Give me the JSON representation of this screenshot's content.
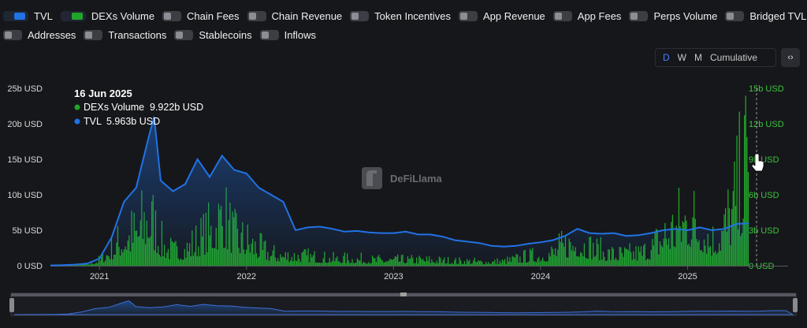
{
  "toggles": [
    {
      "label": "TVL",
      "on": true,
      "color": "#2172e5"
    },
    {
      "label": "DEXs Volume",
      "on": true,
      "color": "#21a529"
    },
    {
      "label": "Chain Fees",
      "on": false
    },
    {
      "label": "Chain Revenue",
      "on": false
    },
    {
      "label": "Token Incentives",
      "on": false
    },
    {
      "label": "App Revenue",
      "on": false
    },
    {
      "label": "App Fees",
      "on": false
    },
    {
      "label": "Perps Volume",
      "on": false
    },
    {
      "label": "Bridged TVL",
      "on": false
    },
    {
      "label": "Addresses",
      "on": false
    },
    {
      "label": "Transactions",
      "on": false
    },
    {
      "label": "Stablecoins",
      "on": false
    },
    {
      "label": "Inflows",
      "on": false
    }
  ],
  "intervals": {
    "options": [
      "D",
      "W",
      "M",
      "Cumulative"
    ],
    "selected": "D"
  },
  "embed_label": "‹›",
  "watermark": "DeFiLlama",
  "tooltip": {
    "date": "16 Jun 2025",
    "rows": [
      {
        "label": "DEXs Volume",
        "value": "9.922b USD",
        "color": "#21a529"
      },
      {
        "label": "TVL",
        "value": "5.963b USD",
        "color": "#2172e5"
      }
    ]
  },
  "chart_data": {
    "type": "area",
    "x_ticks": [
      "2021",
      "2022",
      "2023",
      "2024",
      "2025"
    ],
    "x_range": [
      "2020-09",
      "2025-06"
    ],
    "y_left": {
      "ticks": [
        "0 USD",
        "5b USD",
        "10b USD",
        "15b USD",
        "20b USD",
        "25b USD"
      ],
      "range": [
        0,
        25
      ]
    },
    "y_right": {
      "ticks": [
        "0 USD",
        "3b USD",
        "6b USD",
        "9b USD",
        "12b USD",
        "15b USD"
      ],
      "range": [
        0,
        15
      ]
    },
    "grid": false,
    "series": [
      {
        "name": "TVL",
        "axis": "left",
        "color": "#2172e5",
        "style": "area",
        "x": [
          "2020-09",
          "2020-10",
          "2020-11",
          "2020-12",
          "2021-01",
          "2021-02",
          "2021-03",
          "2021-04",
          "2021-05-01",
          "2021-05-15",
          "2021-06",
          "2021-07",
          "2021-08",
          "2021-09",
          "2021-10",
          "2021-11",
          "2021-12",
          "2022-01",
          "2022-02",
          "2022-03",
          "2022-04",
          "2022-05",
          "2022-06",
          "2022-07",
          "2022-08",
          "2022-09",
          "2022-10",
          "2022-11",
          "2022-12",
          "2023-01",
          "2023-02",
          "2023-03",
          "2023-04",
          "2023-05",
          "2023-06",
          "2023-07",
          "2023-08",
          "2023-09",
          "2023-10",
          "2023-11",
          "2023-12",
          "2024-01",
          "2024-02",
          "2024-03",
          "2024-04",
          "2024-05",
          "2024-06",
          "2024-07",
          "2024-08",
          "2024-09",
          "2024-10",
          "2024-11",
          "2024-12",
          "2025-01",
          "2025-02",
          "2025-03",
          "2025-04",
          "2025-05",
          "2025-06"
        ],
        "y": [
          0.05,
          0.08,
          0.15,
          0.3,
          1.0,
          4.0,
          9.0,
          11.0,
          18.0,
          21.0,
          12.0,
          10.5,
          11.5,
          15.0,
          12.5,
          15.5,
          13.5,
          13.0,
          11.0,
          10.0,
          9.0,
          5.0,
          5.4,
          5.5,
          5.2,
          4.8,
          4.9,
          4.7,
          4.6,
          4.6,
          4.8,
          4.4,
          4.4,
          4.1,
          3.6,
          3.4,
          3.2,
          2.8,
          2.7,
          2.8,
          3.1,
          3.3,
          3.6,
          4.2,
          5.2,
          4.6,
          4.5,
          4.6,
          4.2,
          4.3,
          4.6,
          5.0,
          5.2,
          5.0,
          5.4,
          5.0,
          5.2,
          5.9,
          5.963
        ]
      },
      {
        "name": "DEXs Volume",
        "axis": "right",
        "color": "#21a529",
        "style": "bars",
        "x": [
          "2020-09",
          "2020-10",
          "2020-11",
          "2020-12",
          "2021-01",
          "2021-02",
          "2021-03",
          "2021-04",
          "2021-05-01",
          "2021-05-15",
          "2021-06",
          "2021-07",
          "2021-08",
          "2021-09",
          "2021-10",
          "2021-11",
          "2021-12",
          "2022-01",
          "2022-02",
          "2022-03",
          "2022-04",
          "2022-05",
          "2022-06",
          "2022-07",
          "2022-08",
          "2022-09",
          "2022-10",
          "2022-11",
          "2022-12",
          "2023-01",
          "2023-02",
          "2023-03",
          "2023-04",
          "2023-05",
          "2023-06",
          "2023-07",
          "2023-08",
          "2023-09",
          "2023-10",
          "2023-11",
          "2023-12",
          "2024-01",
          "2024-02",
          "2024-03",
          "2024-04",
          "2024-05",
          "2024-06",
          "2024-07",
          "2024-08",
          "2024-09",
          "2024-10",
          "2024-11",
          "2024-12",
          "2025-01",
          "2025-02",
          "2025-03",
          "2025-04",
          "2025-05",
          "2025-06"
        ],
        "y": [
          0.02,
          0.03,
          0.06,
          0.15,
          0.5,
          1.5,
          2.5,
          3.0,
          4.5,
          3.5,
          2.0,
          1.2,
          1.5,
          2.2,
          3.0,
          4.5,
          2.5,
          2.2,
          1.5,
          1.0,
          0.9,
          0.9,
          0.8,
          0.7,
          0.6,
          0.6,
          0.6,
          0.5,
          0.5,
          0.5,
          0.5,
          0.5,
          0.5,
          0.45,
          0.4,
          0.4,
          0.35,
          0.35,
          0.4,
          0.6,
          0.8,
          0.9,
          1.2,
          1.8,
          2.2,
          1.6,
          1.2,
          1.0,
          1.0,
          1.1,
          1.5,
          2.8,
          3.5,
          4.5,
          3.5,
          2.2,
          3.5,
          6.0,
          9.922
        ]
      }
    ]
  }
}
